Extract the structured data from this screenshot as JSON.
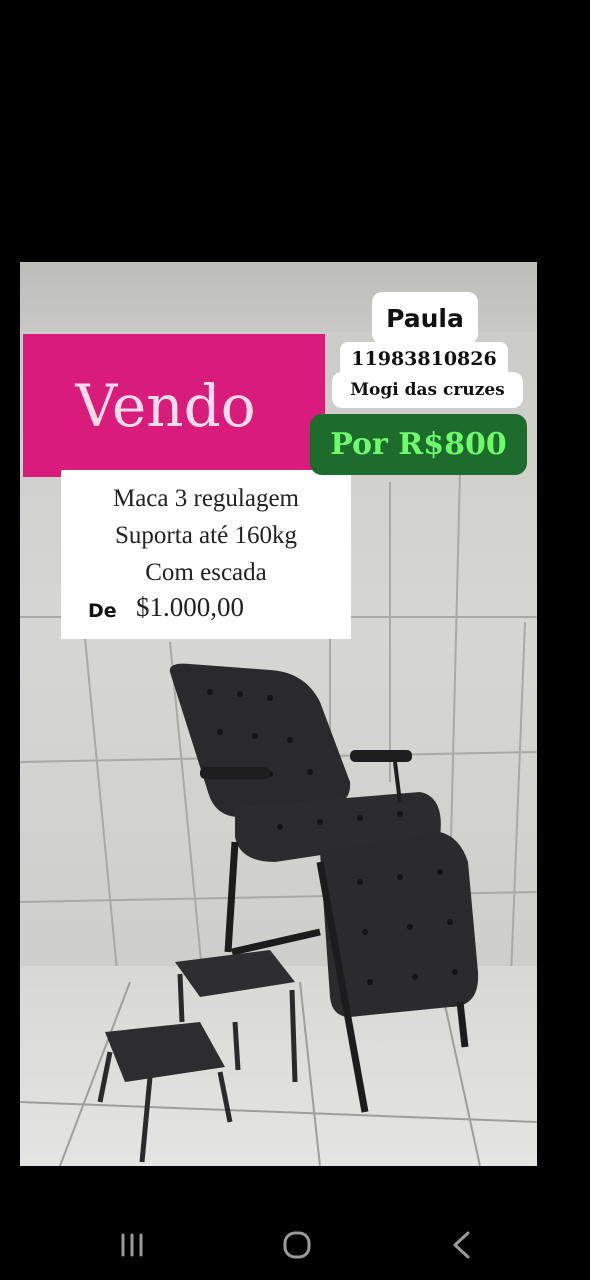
{
  "ad": {
    "headline": "Vendo",
    "description": [
      "Maca 3 regulagem",
      "Suporta até 160kg",
      "Com escada"
    ],
    "old_price_label": "De",
    "old_price": "$1.000,00",
    "promo_price": "Por R$800"
  },
  "contact": {
    "name": "Paula",
    "phone": "11983810826",
    "city": "Mogi das cruzes"
  },
  "colors": {
    "headline_bg": "#d91b7c",
    "promo_bg": "#1d6b2d",
    "promo_text": "#6dfc6a"
  },
  "navbar": {
    "icons": [
      "recent-apps-icon",
      "home-icon",
      "back-icon"
    ]
  }
}
